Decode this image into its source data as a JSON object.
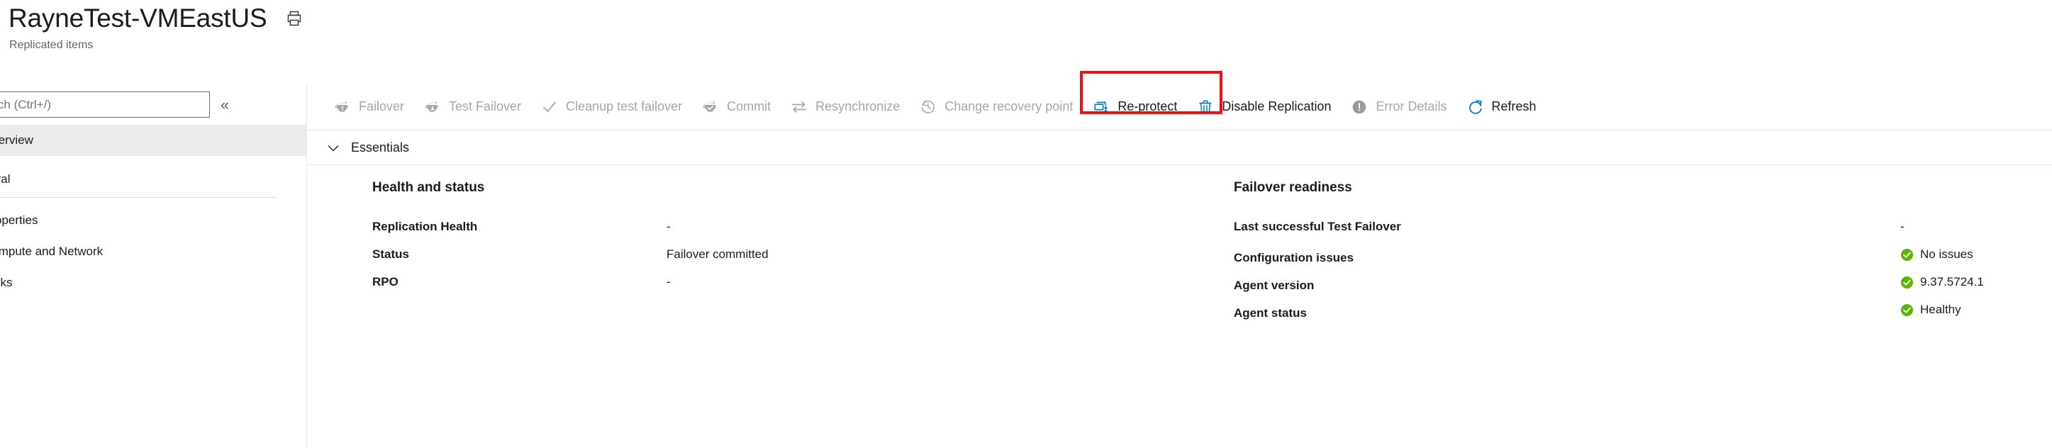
{
  "header": {
    "title": "RayneTest-VMEastUS",
    "subtitle": "Replicated items",
    "print_icon": "print-icon"
  },
  "sidebar": {
    "search": {
      "placeholder": "Search (Ctrl+/)",
      "value": ""
    },
    "collapse_icon": "«",
    "items": [
      {
        "label": "Overview",
        "selected": true,
        "type": "item"
      },
      {
        "label": "General",
        "selected": false,
        "type": "group"
      },
      {
        "label": "Properties",
        "selected": false,
        "type": "item"
      },
      {
        "label": "Compute and Network",
        "selected": false,
        "type": "item"
      },
      {
        "label": "Disks",
        "selected": false,
        "type": "item"
      }
    ]
  },
  "toolbar": {
    "commands": [
      {
        "label": "Failover",
        "icon": "failover-icon",
        "enabled": false,
        "highlighted": false
      },
      {
        "label": "Test Failover",
        "icon": "test-failover-icon",
        "enabled": false,
        "highlighted": false
      },
      {
        "label": "Cleanup test failover",
        "icon": "checkmark-icon",
        "enabled": false,
        "highlighted": false
      },
      {
        "label": "Commit",
        "icon": "commit-icon",
        "enabled": false,
        "highlighted": false
      },
      {
        "label": "Resynchronize",
        "icon": "resynchronize-icon",
        "enabled": false,
        "highlighted": false
      },
      {
        "label": "Change recovery point",
        "icon": "clock-history-icon",
        "enabled": false,
        "highlighted": false
      },
      {
        "label": "Re-protect",
        "icon": "re-protect-icon",
        "enabled": true,
        "highlighted": true
      },
      {
        "label": "Disable Replication",
        "icon": "trash-icon",
        "enabled": true,
        "highlighted": false
      },
      {
        "label": "Error Details",
        "icon": "error-circle-icon",
        "enabled": false,
        "highlighted": false
      },
      {
        "label": "Refresh",
        "icon": "refresh-icon",
        "enabled": true,
        "highlighted": false
      }
    ],
    "annotation_color": "#ee1111"
  },
  "essentials": {
    "label": "Essentials",
    "chevron_icon": "chevron-down-icon",
    "columns": [
      {
        "heading": "Health and status",
        "rows": [
          {
            "key": "Replication Health",
            "value": "-",
            "status": null
          },
          {
            "key": "Status",
            "value": "Failover committed",
            "status": null
          },
          {
            "key": "RPO",
            "value": "-",
            "status": null
          }
        ]
      },
      {
        "heading": "Failover readiness",
        "rows": [
          {
            "key": "Last successful Test Failover",
            "value": "-",
            "status": null
          },
          {
            "key": "Configuration issues",
            "value": "No issues",
            "status": "ok"
          },
          {
            "key": "Agent version",
            "value": "9.37.5724.1",
            "status": "ok"
          },
          {
            "key": "Agent status",
            "value": "Healthy",
            "status": "ok"
          }
        ]
      }
    ],
    "status_color_ok": "#5cb300"
  }
}
